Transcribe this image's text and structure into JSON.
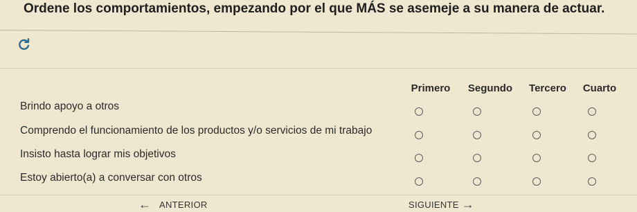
{
  "question": "Ordene los comportamientos, empezando por el que MÁS se asemeje a su manera de actuar.",
  "icons": {
    "reset": "refresh-icon"
  },
  "columns": [
    "Primero",
    "Segundo",
    "Tercero",
    "Cuarto"
  ],
  "rows": [
    {
      "label": "Brindo apoyo a otros"
    },
    {
      "label": "Comprendo el funcionamiento de los productos y/o servicios de mi trabajo"
    },
    {
      "label": "Insisto hasta lograr mis objetivos"
    },
    {
      "label": "Estoy abierto(a) a conversar con otros"
    }
  ],
  "nav": {
    "prev_label": "ANTERIOR",
    "next_label": "SIGUIENTE"
  },
  "colors": {
    "background": "#efe7cf",
    "accent": "#2d6b8f"
  }
}
